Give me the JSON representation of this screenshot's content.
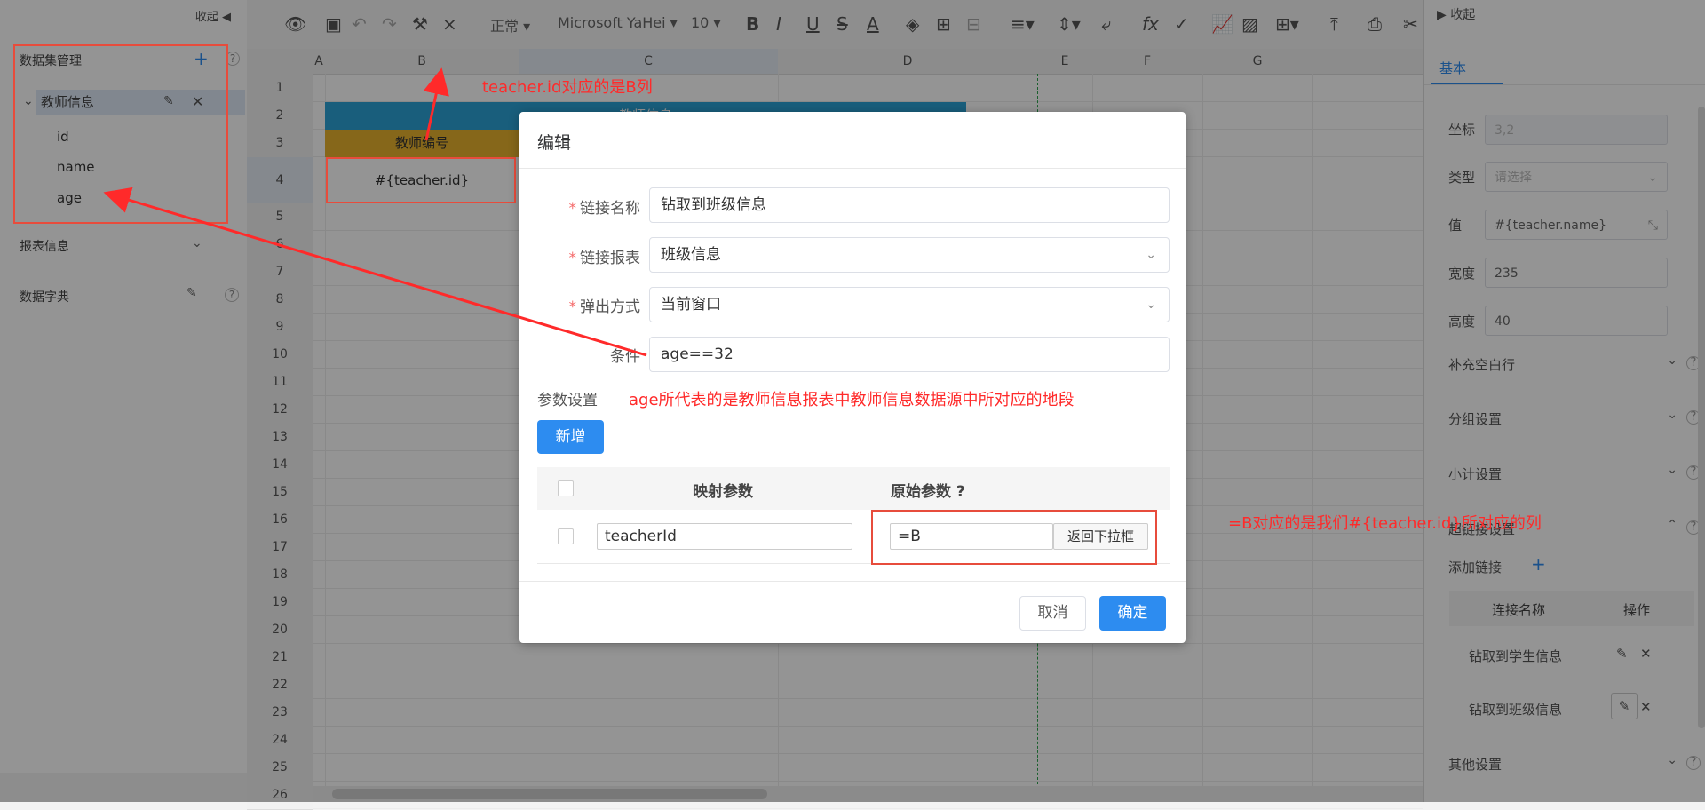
{
  "left_panel": {
    "collapse_label": "收起",
    "dataset_mgmt": "数据集管理",
    "tree_node": "教师信息",
    "fields": [
      "id",
      "name",
      "age"
    ],
    "report_info": "报表信息",
    "data_dict": "数据字典"
  },
  "toolbar": {
    "normal": "正常",
    "font": "Microsoft YaHei",
    "size": "10"
  },
  "grid": {
    "columns": [
      "A",
      "B",
      "C",
      "D",
      "E",
      "F",
      "G"
    ],
    "rows": [
      "1",
      "2",
      "3",
      "4",
      "5",
      "6",
      "7",
      "8",
      "9",
      "10",
      "11",
      "12",
      "13",
      "14",
      "15",
      "16",
      "17",
      "18",
      "19",
      "20",
      "21",
      "22",
      "23",
      "24",
      "25",
      "26"
    ],
    "cell_header_b3": "教师编号",
    "cell_header_row2": "教师信息",
    "cell_b4": "#{teacher.id}"
  },
  "right_panel": {
    "collapse_label": "收起",
    "tab_basic": "基本",
    "coord_label": "坐标",
    "coord_value": "3,2",
    "type_label": "类型",
    "type_placeholder": "请选择",
    "value_label": "值",
    "value_value": "#{teacher.name}",
    "width_label": "宽度",
    "width_value": "235",
    "height_label": "高度",
    "height_value": "40",
    "sections": [
      "补充空白行",
      "分组设置",
      "小计设置",
      "超链接设置"
    ],
    "add_link": "添加链接",
    "link_table_headers": [
      "连接名称",
      "操作"
    ],
    "links": [
      "钻取到学生信息",
      "钻取到班级信息"
    ],
    "other_settings": "其他设置"
  },
  "dialog": {
    "title": "编辑",
    "link_name_label": "链接名称",
    "link_name_value": "钻取到班级信息",
    "link_report_label": "链接报表",
    "link_report_value": "班级信息",
    "popup_label": "弹出方式",
    "popup_value": "当前窗口",
    "condition_label": "条件",
    "condition_value": "age==32",
    "param_label": "参数设置",
    "add_button": "新增",
    "table_headers": [
      "映射参数",
      "原始参数 ?"
    ],
    "mapped_param": "teacherId",
    "original_param": "=B",
    "return_dropdown": "返回下拉框",
    "cancel": "取消",
    "confirm": "确定"
  },
  "annotations": {
    "a1": "teacher.id对应的是B列",
    "a2": "age所代表的是教师信息报表中教师信息数据源中所对应的地段",
    "a3": "=B对应的是我们#{teacher.id}所对应的列"
  },
  "colors": {
    "primary": "#2d8cf0",
    "annotation": "#ff2a2a",
    "header_blue": "#2ba3d6",
    "header_gold": "#e7b12e"
  }
}
